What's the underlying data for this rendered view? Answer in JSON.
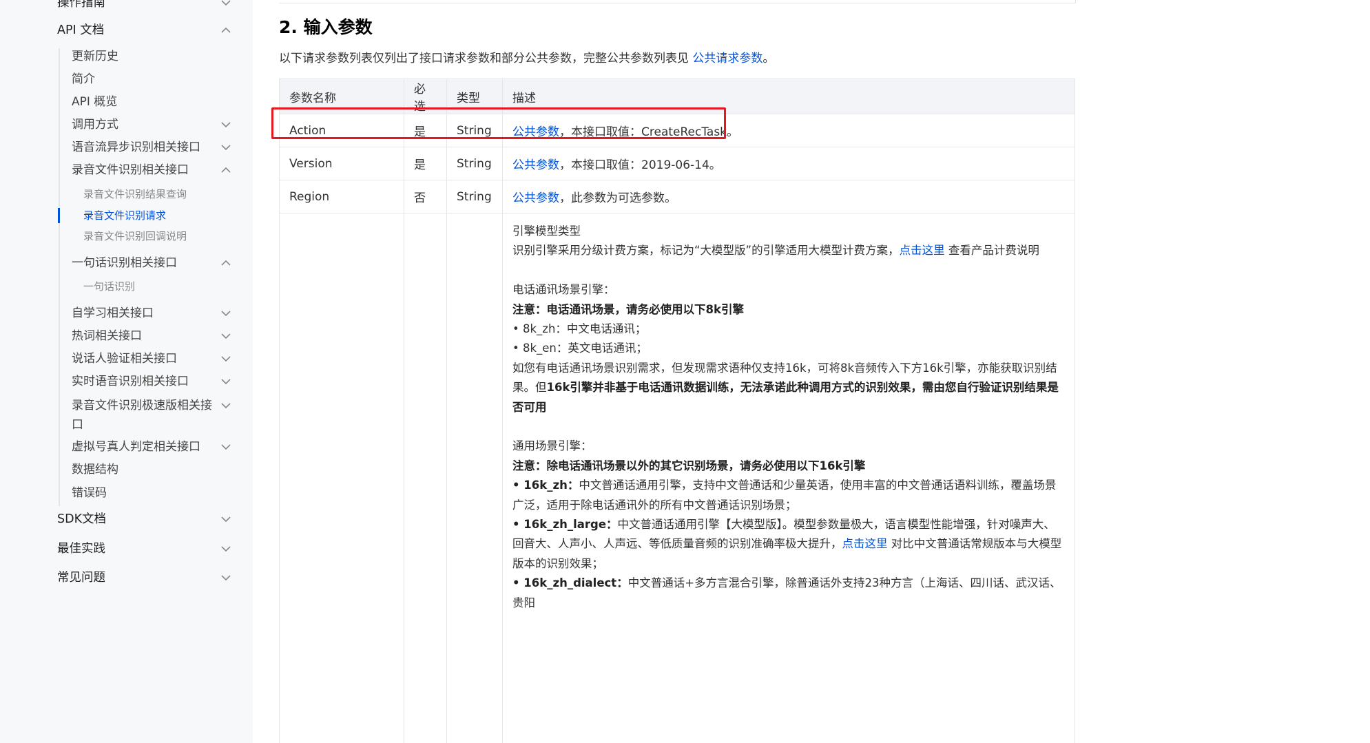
{
  "sidebar": {
    "items": [
      {
        "label": "操作指南",
        "level": 1
      },
      {
        "label": "API 文档",
        "level": 1
      },
      {
        "label": "更新历史",
        "level": 2
      },
      {
        "label": "简介",
        "level": 2
      },
      {
        "label": "API 概览",
        "level": 2
      },
      {
        "label": "调用方式",
        "level": 2
      },
      {
        "label": "语音流异步识别相关接口",
        "level": 2
      },
      {
        "label": "录音文件识别相关接口",
        "level": 2
      },
      {
        "label": "录音文件识别结果查询",
        "level": 3
      },
      {
        "label": "录音文件识别请求",
        "level": 3,
        "active": true
      },
      {
        "label": "录音文件识别回调说明",
        "level": 3
      },
      {
        "label": "一句话识别相关接口",
        "level": 2
      },
      {
        "label": "一句话识别",
        "level": 3
      },
      {
        "label": "自学习相关接口",
        "level": 2
      },
      {
        "label": "热词相关接口",
        "level": 2
      },
      {
        "label": "说话人验证相关接口",
        "level": 2
      },
      {
        "label": "实时语音识别相关接口",
        "level": 2
      },
      {
        "label": "录音文件识别极速版相关接口",
        "level": 2
      },
      {
        "label": "虚拟号真人判定相关接口",
        "level": 2
      },
      {
        "label": "数据结构",
        "level": 2
      },
      {
        "label": "错误码",
        "level": 2
      },
      {
        "label": "SDK文档",
        "level": 1
      },
      {
        "label": "最佳实践",
        "level": 1
      },
      {
        "label": "常见问题",
        "level": 1
      }
    ]
  },
  "main": {
    "section_title": "2. 输入参数",
    "intro_text": "以下请求参数列表仅列出了接口请求参数和部分公共参数，完整公共参数列表见 ",
    "intro_link": "公共请求参数",
    "intro_end": "。",
    "table": {
      "headers": [
        "参数名称",
        "必选",
        "类型",
        "描述"
      ],
      "rows": [
        {
          "name": "Action",
          "required": "是",
          "type": "String",
          "desc_link": "公共参数",
          "desc": "，本接口取值：CreateRecTask。"
        },
        {
          "name": "Version",
          "required": "是",
          "type": "String",
          "desc_link": "公共参数",
          "desc": "，本接口取值：2019-06-14。"
        },
        {
          "name": "Region",
          "required": "否",
          "type": "String",
          "desc_link": "公共参数",
          "desc": "，此参数为可选参数。"
        }
      ],
      "engine": {
        "title": "引擎模型类型",
        "line2_a": "识别引擎采用分级计费方案，标记为“大模型版”的引擎适用大模型计费方案，",
        "line2_link": "点击这里",
        "line2_b": " 查看产品计费说明",
        "phone_title": "电话通讯场景引擎：",
        "phone_note": "注意：电话通讯场景，请务必使用以下8k引擎",
        "phone_item1": "• 8k_zh：中文电话通讯；",
        "phone_item2": "• 8k_en：英文电话通讯；",
        "phone_para_a": "如您有电话通讯场景识别需求，但发现需求语种仅支持16k，可将8k音频传入下方16k引擎，亦能获取识别结果。但",
        "phone_para_b": "16k引擎并非基于电话通讯数据训练，无法承诺此种调用方式的识别效果，需由您自行验证识别结果是否可用",
        "general_title": "通用场景引擎：",
        "general_note": "注意：除电话通讯场景以外的其它识别场景，请务必使用以下16k引擎",
        "item_zh_key": "• 16k_zh：",
        "item_zh_text": "中文普通话通用引擎，支持中文普通话和少量英语，使用丰富的中文普通话语料训练，覆盖场景广泛，适用于除电话通讯外的所有中文普通话识别场景；",
        "item_large_key": "• 16k_zh_large：",
        "item_large_text": "中文普通话通用引擎【大模型版】。模型参数量极大，语言模型性能增强，针对噪声大、回音大、人声小、人声远、等低质量音频的识别准确率极大提升，",
        "item_large_link": "点击这里",
        "item_large_end": " 对比中文普通话常规版本与大模型版本的识别效果；",
        "item_dialect_key": "• 16k_zh_dialect：",
        "item_dialect_text": "中文普通话+多方言混合引擎，除普通话外支持23种方言（上海话、四川话、武汉话、贵阳"
      }
    }
  },
  "colors": {
    "link": "#0052d9",
    "highlight": "#e4161f",
    "sidebar_bg": "#f7f8fa",
    "header_bg": "#f3f4f7"
  }
}
